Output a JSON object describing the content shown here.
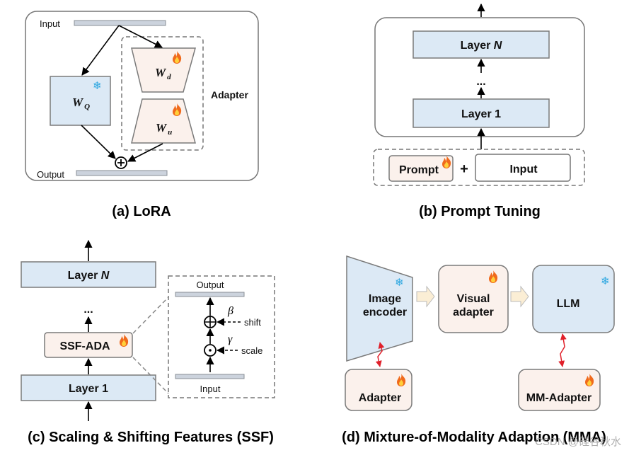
{
  "colors": {
    "frozen_fill": "#dce9f5",
    "trainable_fill": "#fbf1ec",
    "io_bar": "#ccd3dd",
    "fire": "#f06a1c",
    "snowflake": "#2aa6e0",
    "bidirectional_arrow": "#e0202a"
  },
  "icons": {
    "trainable": "fire-icon",
    "frozen": "snowflake-icon"
  },
  "lora": {
    "input": "Input",
    "output": "Output",
    "wq": "W",
    "wq_sub": "Q",
    "wd": "W",
    "wd_sub": "d",
    "wu": "W",
    "wu_sub": "u",
    "adapter": "Adapter",
    "plus": "⊕",
    "title": "(a) LoRA"
  },
  "prompt_tuning": {
    "layer_n": "Layer",
    "layer_n_var": "N",
    "dots": "...",
    "layer_1": "Layer 1",
    "prompt": "Prompt",
    "plus": "+",
    "input": "Input",
    "title": "(b) Prompt Tuning"
  },
  "ssf": {
    "layer_n": "Layer",
    "layer_n_var": "N",
    "dots": "...",
    "ssf_ada": "SSF-ADA",
    "layer_1": "Layer 1",
    "output": "Output",
    "input": "Input",
    "beta": "β",
    "gamma": "γ",
    "shift": "shift",
    "scale": "scale",
    "title": "(c) Scaling & Shifting Features (SSF)"
  },
  "mma": {
    "image_encoder_1": "Image",
    "image_encoder_2": "encoder",
    "visual_adapter_1": "Visual",
    "visual_adapter_2": "adapter",
    "llm": "LLM",
    "adapter": "Adapter",
    "mm_adapter": "MM-Adapter",
    "title": "(d) Mixture-of-Modality Adaption (MMA)"
  },
  "watermark": "CSDN @硅谷秋水"
}
